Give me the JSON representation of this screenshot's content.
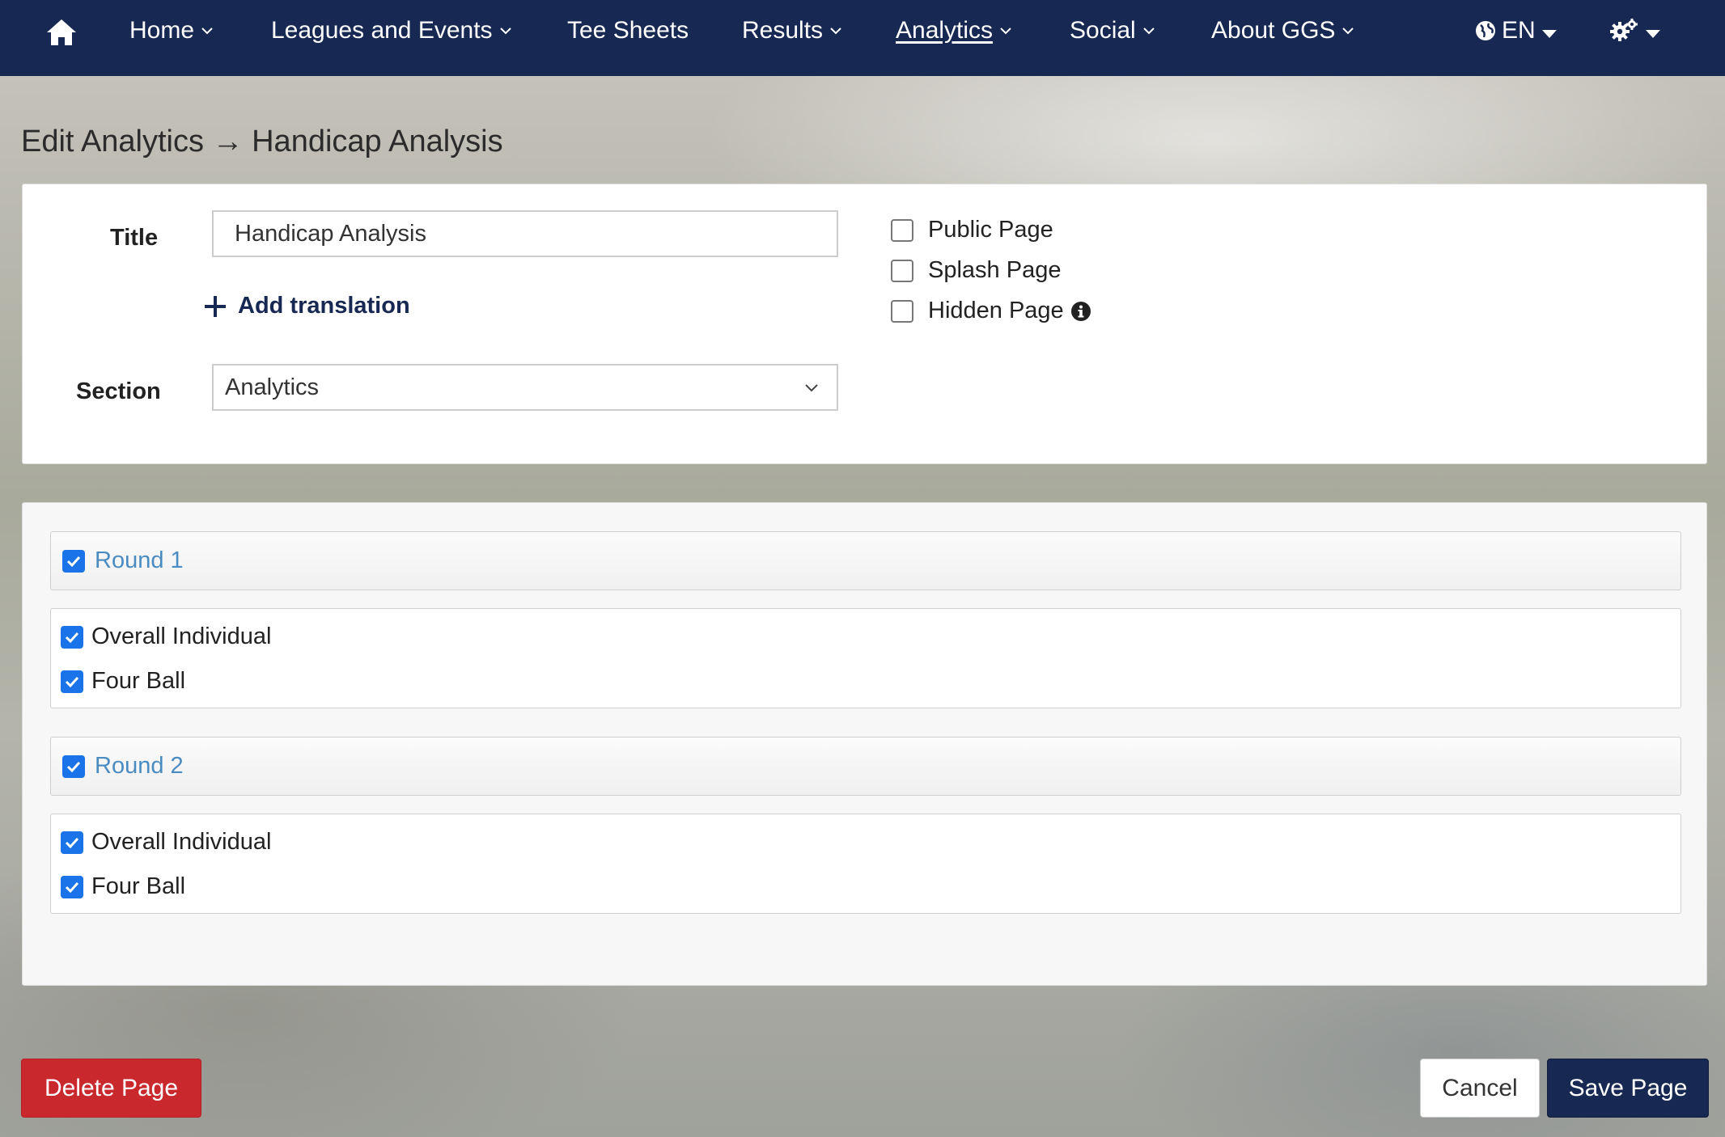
{
  "nav": {
    "items": [
      {
        "label": "Home",
        "dropdown": true
      },
      {
        "label": "Leagues and Events",
        "dropdown": true
      },
      {
        "label": "Tee Sheets",
        "dropdown": false
      },
      {
        "label": "Results",
        "dropdown": true
      },
      {
        "label": "Analytics",
        "dropdown": true,
        "active": true
      },
      {
        "label": "Social",
        "dropdown": true
      },
      {
        "label": "About GGS",
        "dropdown": true
      }
    ],
    "language": "EN",
    "icons": [
      "home-icon",
      "globe-icon",
      "gears-icon"
    ]
  },
  "page_title": "Edit Analytics → Handicap Analysis",
  "form": {
    "title_label": "Title",
    "title_value": "Handicap Analysis",
    "add_translation_label": "Add translation",
    "section_label": "Section",
    "section_value": "Analytics",
    "options": [
      {
        "label": "Public Page",
        "checked": false
      },
      {
        "label": "Splash Page",
        "checked": false
      },
      {
        "label": "Hidden Page",
        "checked": false,
        "info": true
      }
    ]
  },
  "rounds": [
    {
      "label": "Round 1",
      "checked": true,
      "items": [
        {
          "label": "Overall Individual",
          "checked": true
        },
        {
          "label": "Four Ball",
          "checked": true
        }
      ]
    },
    {
      "label": "Round 2",
      "checked": true,
      "items": [
        {
          "label": "Overall Individual",
          "checked": true
        },
        {
          "label": "Four Ball",
          "checked": true
        }
      ]
    }
  ],
  "buttons": {
    "delete": "Delete Page",
    "cancel": "Cancel",
    "save": "Save Page"
  },
  "colors": {
    "navbar": "#172852",
    "delete": "#c9282d",
    "checkbox": "#1a73e8",
    "round_link": "#4a8bc2"
  }
}
